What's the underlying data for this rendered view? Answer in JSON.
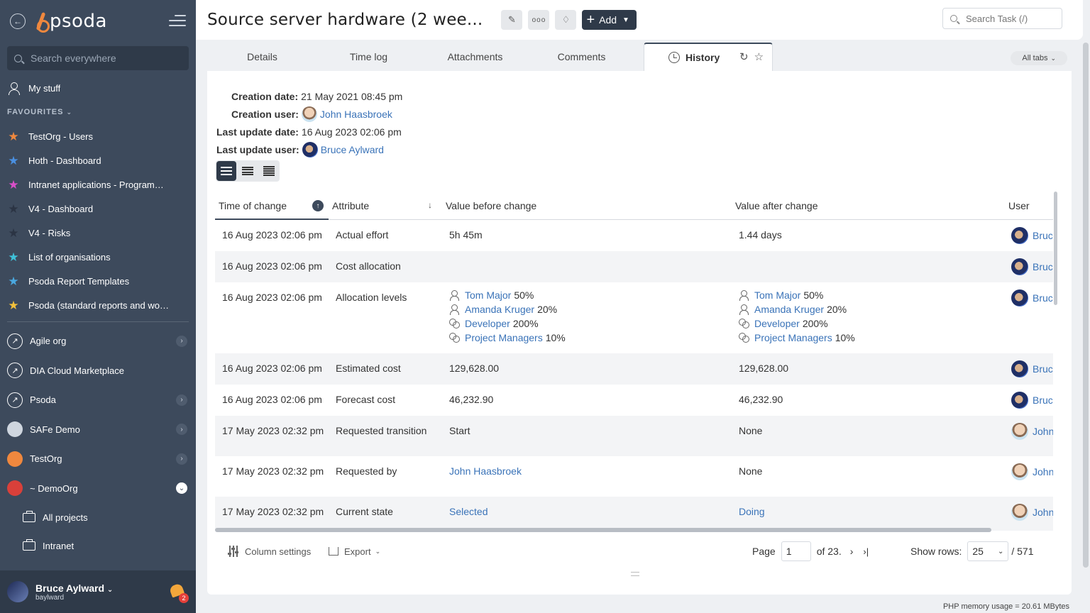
{
  "sidebar": {
    "search_placeholder": "Search everywhere",
    "my_stuff": "My stuff",
    "favourites_label": "FAVOURITES",
    "favourites": [
      {
        "label": "TestOrg - Users",
        "color": "#f0883e"
      },
      {
        "label": "Hoth - Dashboard",
        "color": "#4a90e2"
      },
      {
        "label": "Intranet applications - Programme...",
        "color": "#d94fc8"
      },
      {
        "label": "V4 - Dashboard",
        "color": "#2b3444"
      },
      {
        "label": "V4 - Risks",
        "color": "#2b3444"
      },
      {
        "label": "List of organisations",
        "color": "#3fc1d9"
      },
      {
        "label": "Psoda Report Templates",
        "color": "#4aa8e0"
      },
      {
        "label": "Psoda (standard reports and work...",
        "color": "#f3c13b"
      }
    ],
    "orgs": [
      {
        "label": "Agile org",
        "has_arrow": true
      },
      {
        "label": "DIA Cloud Marketplace",
        "has_arrow": false
      },
      {
        "label": "Psoda",
        "has_arrow": true
      },
      {
        "label": "SAFe Demo",
        "has_arrow": true
      },
      {
        "label": "TestOrg",
        "has_arrow": true
      },
      {
        "label": "~ DemoOrg",
        "has_arrow": true
      }
    ],
    "sub_items": [
      "All projects",
      "Intranet"
    ],
    "user": {
      "name": "Bruce Aylward",
      "username": "baylward",
      "notifications": "2"
    }
  },
  "header": {
    "title": "Source server hardware (2 wee...",
    "add_label": "Add",
    "search_placeholder": "Search Task (/)"
  },
  "tabs": {
    "items": [
      "Details",
      "Time log",
      "Attachments",
      "Comments"
    ],
    "active": "History",
    "all_tabs": "All tabs"
  },
  "meta": {
    "creation_date_label": "Creation date:",
    "creation_date": "21 May 2021 08:45 pm",
    "creation_user_label": "Creation user:",
    "creation_user": "John Haasbroek",
    "last_update_date_label": "Last update date:",
    "last_update_date": "16 Aug 2023 02:06 pm",
    "last_update_user_label": "Last update user:",
    "last_update_user": "Bruce Aylward"
  },
  "table": {
    "columns": {
      "time": "Time of change",
      "attribute": "Attribute",
      "before": "Value before change",
      "after": "Value after change",
      "user": "User"
    },
    "rows": [
      {
        "time": "16 Aug 2023 02:06 pm",
        "attribute": "Actual effort",
        "before": "5h 45m",
        "after": "1.44 days",
        "user": "Bruce Aylward",
        "avatar": "bruce"
      },
      {
        "time": "16 Aug 2023 02:06 pm",
        "attribute": "Cost allocation",
        "before": "",
        "after": "",
        "user": "Bruce Aylward",
        "avatar": "bruce"
      },
      {
        "time": "16 Aug 2023 02:06 pm",
        "attribute": "Allocation levels",
        "before_alloc": [
          {
            "kind": "person",
            "name": "Tom Major",
            "pct": "50%"
          },
          {
            "kind": "person",
            "name": "Amanda Kruger",
            "pct": "20%"
          },
          {
            "kind": "group",
            "name": "Developer",
            "pct": "200%"
          },
          {
            "kind": "group",
            "name": "Project Managers",
            "pct": "10%"
          }
        ],
        "after_alloc": [
          {
            "kind": "person",
            "name": "Tom Major",
            "pct": "50%"
          },
          {
            "kind": "person",
            "name": "Amanda Kruger",
            "pct": "20%"
          },
          {
            "kind": "group",
            "name": "Developer",
            "pct": "200%"
          },
          {
            "kind": "group",
            "name": "Project Managers",
            "pct": "10%"
          }
        ],
        "user": "Bruce Aylward",
        "avatar": "bruce"
      },
      {
        "time": "16 Aug 2023 02:06 pm",
        "attribute": "Estimated cost",
        "before": "129,628.00",
        "after": "129,628.00",
        "user": "Bruce Aylward",
        "avatar": "bruce"
      },
      {
        "time": "16 Aug 2023 02:06 pm",
        "attribute": "Forecast cost",
        "before": "46,232.90",
        "after": "46,232.90",
        "user": "Bruce Aylward",
        "avatar": "bruce"
      },
      {
        "time": "17 May 2023 02:32 pm",
        "attribute": "Requested transition",
        "before": "Start",
        "after": "None",
        "user": "John Haasbroek",
        "avatar": "john"
      },
      {
        "time": "17 May 2023 02:32 pm",
        "attribute": "Requested by",
        "before": "John Haasbroek",
        "before_link": true,
        "after": "None",
        "user": "John Haasbroek",
        "avatar": "john"
      },
      {
        "time": "17 May 2023 02:32 pm",
        "attribute": "Current state",
        "before": "Selected",
        "before_link": true,
        "after": "Doing",
        "after_link": true,
        "user": "John Haasbroek",
        "avatar": "john"
      }
    ]
  },
  "footer": {
    "column_settings": "Column settings",
    "export": "Export",
    "page_label": "Page",
    "page_value": "1",
    "page_of": "of 23.",
    "show_rows_label": "Show rows:",
    "rows_value": "25",
    "total": "/ 571"
  },
  "memory": "PHP memory usage = 20.61 MBytes"
}
